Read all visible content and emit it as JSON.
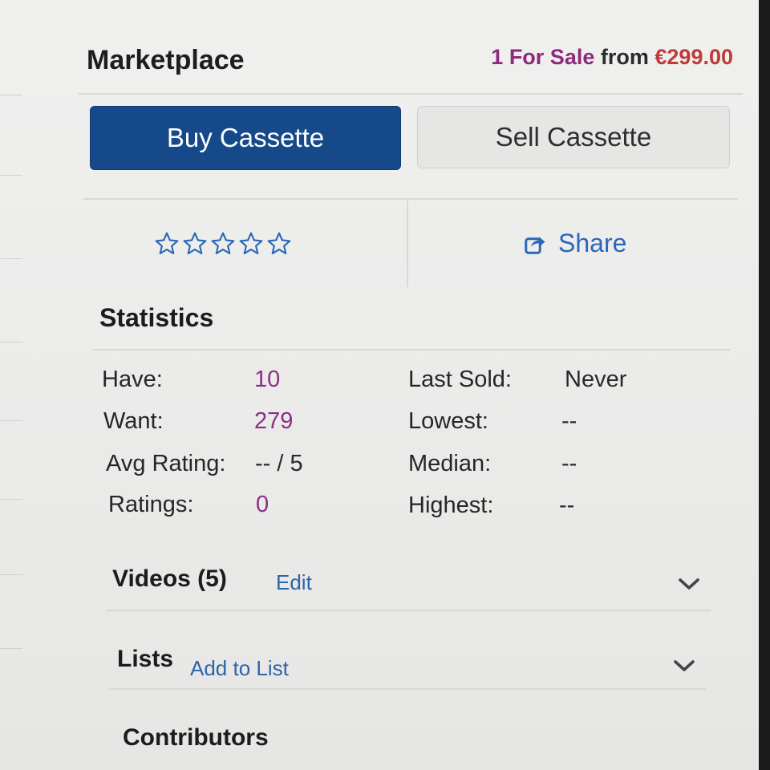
{
  "marketplace": {
    "title": "Marketplace",
    "for_sale_count": "1 For Sale",
    "for_sale_from": "from",
    "for_sale_price": "€299.00",
    "buy_label": "Buy Cassette",
    "sell_label": "Sell Cassette"
  },
  "rating": {
    "stars_filled": 0,
    "stars_total": 5
  },
  "share": {
    "label": "Share"
  },
  "statistics": {
    "title": "Statistics",
    "left": [
      {
        "label": "Have:",
        "value": "10"
      },
      {
        "label": "Want:",
        "value": "279"
      },
      {
        "label": "Avg Rating:",
        "value": "-- / 5"
      },
      {
        "label": "Ratings:",
        "value": "0"
      }
    ],
    "right": [
      {
        "label": "Last Sold:",
        "value": "Never"
      },
      {
        "label": "Lowest:",
        "value": "--"
      },
      {
        "label": "Median:",
        "value": "--"
      },
      {
        "label": "Highest:",
        "value": "--"
      }
    ]
  },
  "sections": {
    "videos": {
      "title": "Videos (5)",
      "action": "Edit"
    },
    "lists": {
      "title": "Lists",
      "action": "Add to List"
    },
    "contributors": {
      "title": "Contributors"
    }
  },
  "colors": {
    "accent_blue": "#15498a",
    "link_blue": "#2a67b8",
    "count_purple": "#8c2f84",
    "price_red": "#c03a3a"
  },
  "icons": [
    "star-outline-icon",
    "share-icon",
    "chevron-down-icon"
  ]
}
